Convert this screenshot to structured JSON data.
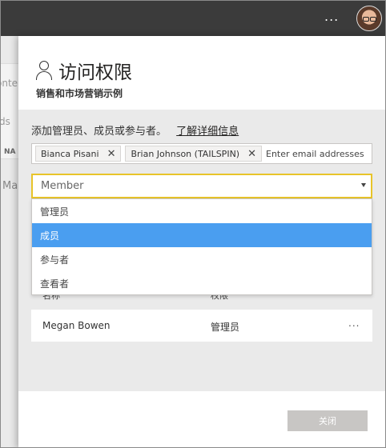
{
  "topbar": {
    "more_label": "...",
    "avatar_alt": "user-avatar"
  },
  "background": {
    "labels": [
      "onte",
      "ds",
      "NA",
      "Ma"
    ]
  },
  "panel": {
    "title": "访问权限",
    "subtitle": "销售和市场营销示例",
    "add_text": "添加管理员、成员或参与者。",
    "learn_more": "了解详细信息",
    "chips": [
      {
        "name": "Bianca Pisani",
        "remove": "✕"
      },
      {
        "name": "Brian Johnson (TAILSPIN)",
        "remove": "✕"
      }
    ],
    "email_placeholder": "Enter email addresses",
    "role_selected": "Member",
    "role_options": [
      {
        "label": "管理员",
        "selected": false
      },
      {
        "label": "成员",
        "selected": true
      },
      {
        "label": "参与者",
        "selected": false
      },
      {
        "label": "查看者",
        "selected": false
      }
    ],
    "table": {
      "headers": [
        "名称",
        "权限"
      ],
      "rows": [
        {
          "name": "Megan Bowen",
          "permission": "管理员",
          "more": "..."
        }
      ]
    },
    "close_label": "关闭"
  },
  "colors": {
    "accent_border": "#e8c42a",
    "selected_option": "#4a9ef0",
    "topbar": "#3b3b3b"
  }
}
